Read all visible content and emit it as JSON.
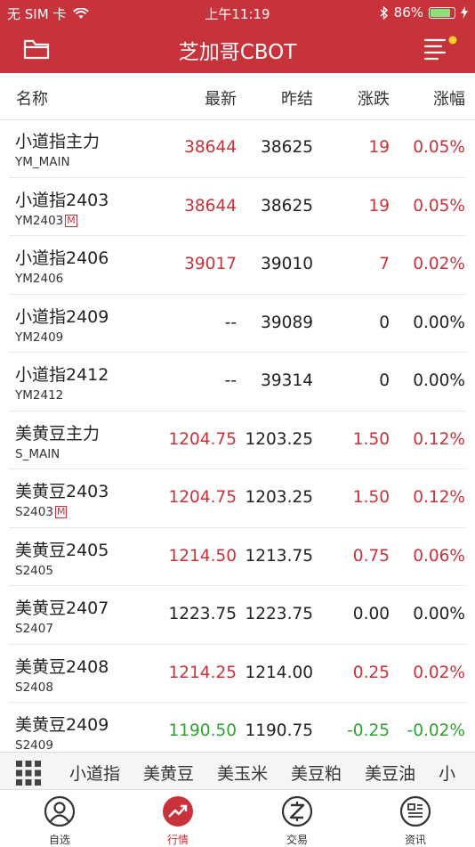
{
  "status": {
    "carrier": "无 SIM 卡",
    "time": "上午11:19",
    "battery": "86%",
    "battery_level": 0.86
  },
  "nav": {
    "title": "芝加哥CBOT"
  },
  "columns": {
    "name": "名称",
    "latest": "最新",
    "prev": "昨结",
    "change": "涨跌",
    "pct": "涨幅"
  },
  "rows": [
    {
      "name": "小道指主力",
      "code": "YM_MAIN",
      "badge": "",
      "latest": "38644",
      "prev": "38625",
      "change": "19",
      "pct": "0.05%",
      "dir": "red"
    },
    {
      "name": "小道指2403",
      "code": "YM2403",
      "badge": "M",
      "latest": "38644",
      "prev": "38625",
      "change": "19",
      "pct": "0.05%",
      "dir": "red"
    },
    {
      "name": "小道指2406",
      "code": "YM2406",
      "badge": "",
      "latest": "39017",
      "prev": "39010",
      "change": "7",
      "pct": "0.02%",
      "dir": "red"
    },
    {
      "name": "小道指2409",
      "code": "YM2409",
      "badge": "",
      "latest": "--",
      "prev": "39089",
      "change": "0",
      "pct": "0.00%",
      "dir": "black"
    },
    {
      "name": "小道指2412",
      "code": "YM2412",
      "badge": "",
      "latest": "--",
      "prev": "39314",
      "change": "0",
      "pct": "0.00%",
      "dir": "black"
    },
    {
      "name": "美黄豆主力",
      "code": "S_MAIN",
      "badge": "",
      "latest": "1204.75",
      "prev": "1203.25",
      "change": "1.50",
      "pct": "0.12%",
      "dir": "red"
    },
    {
      "name": "美黄豆2403",
      "code": "S2403",
      "badge": "M",
      "latest": "1204.75",
      "prev": "1203.25",
      "change": "1.50",
      "pct": "0.12%",
      "dir": "red"
    },
    {
      "name": "美黄豆2405",
      "code": "S2405",
      "badge": "",
      "latest": "1214.50",
      "prev": "1213.75",
      "change": "0.75",
      "pct": "0.06%",
      "dir": "red"
    },
    {
      "name": "美黄豆2407",
      "code": "S2407",
      "badge": "",
      "latest": "1223.75",
      "prev": "1223.75",
      "change": "0.00",
      "pct": "0.00%",
      "dir": "black"
    },
    {
      "name": "美黄豆2408",
      "code": "S2408",
      "badge": "",
      "latest": "1214.25",
      "prev": "1214.00",
      "change": "0.25",
      "pct": "0.02%",
      "dir": "red"
    },
    {
      "name": "美黄豆2409",
      "code": "S2409",
      "badge": "",
      "latest": "1190.50",
      "prev": "1190.75",
      "change": "-0.25",
      "pct": "-0.02%",
      "dir": "green"
    }
  ],
  "categories": [
    "小道指",
    "美黄豆",
    "美玉米",
    "美豆粕",
    "美豆油",
    "小"
  ],
  "tabs": [
    {
      "label": "自选",
      "icon": "user-icon",
      "active": false
    },
    {
      "label": "行情",
      "icon": "trend-up-icon",
      "active": true
    },
    {
      "label": "交易",
      "icon": "trade-icon",
      "active": false
    },
    {
      "label": "资讯",
      "icon": "news-icon",
      "active": false
    }
  ],
  "colors": {
    "brand": "#c8323a",
    "up": "#c8323a",
    "down": "#2ea32e"
  }
}
